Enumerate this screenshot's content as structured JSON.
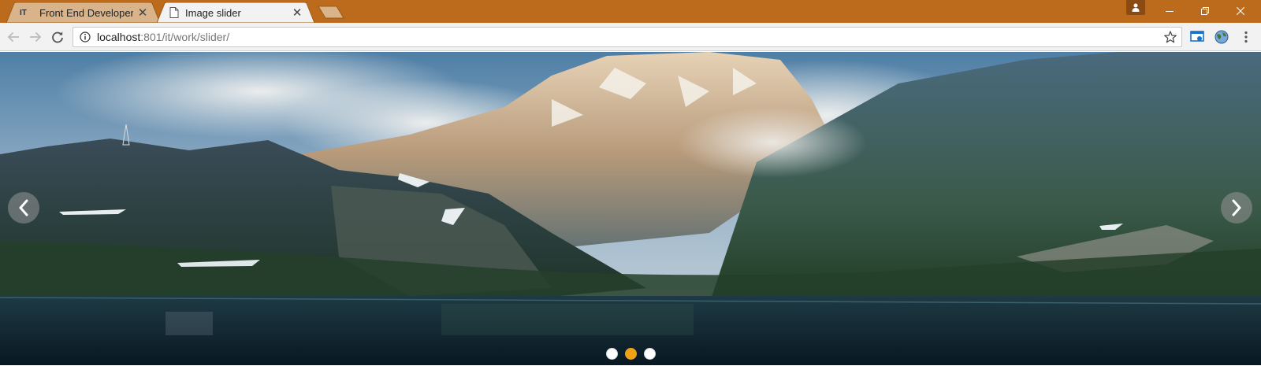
{
  "browser": {
    "tabs": [
      {
        "favicon_text": "IT",
        "title": "Front End Developer",
        "close": "✕",
        "active": false
      },
      {
        "favicon": "document-icon",
        "title": "Image slider",
        "close": "✕",
        "active": true
      }
    ],
    "window_controls": {
      "minimize": "—",
      "maximize": "❐",
      "close": "✕"
    },
    "accent_color": "#bc6b1c"
  },
  "toolbar": {
    "url_host": "localhost",
    "url_rest": ":801/it/work/slider/"
  },
  "slider": {
    "prev_label": "‹",
    "next_label": "›",
    "dots": [
      {
        "active": false
      },
      {
        "active": true
      },
      {
        "active": false
      }
    ],
    "active_dot_color": "#f0a216"
  }
}
